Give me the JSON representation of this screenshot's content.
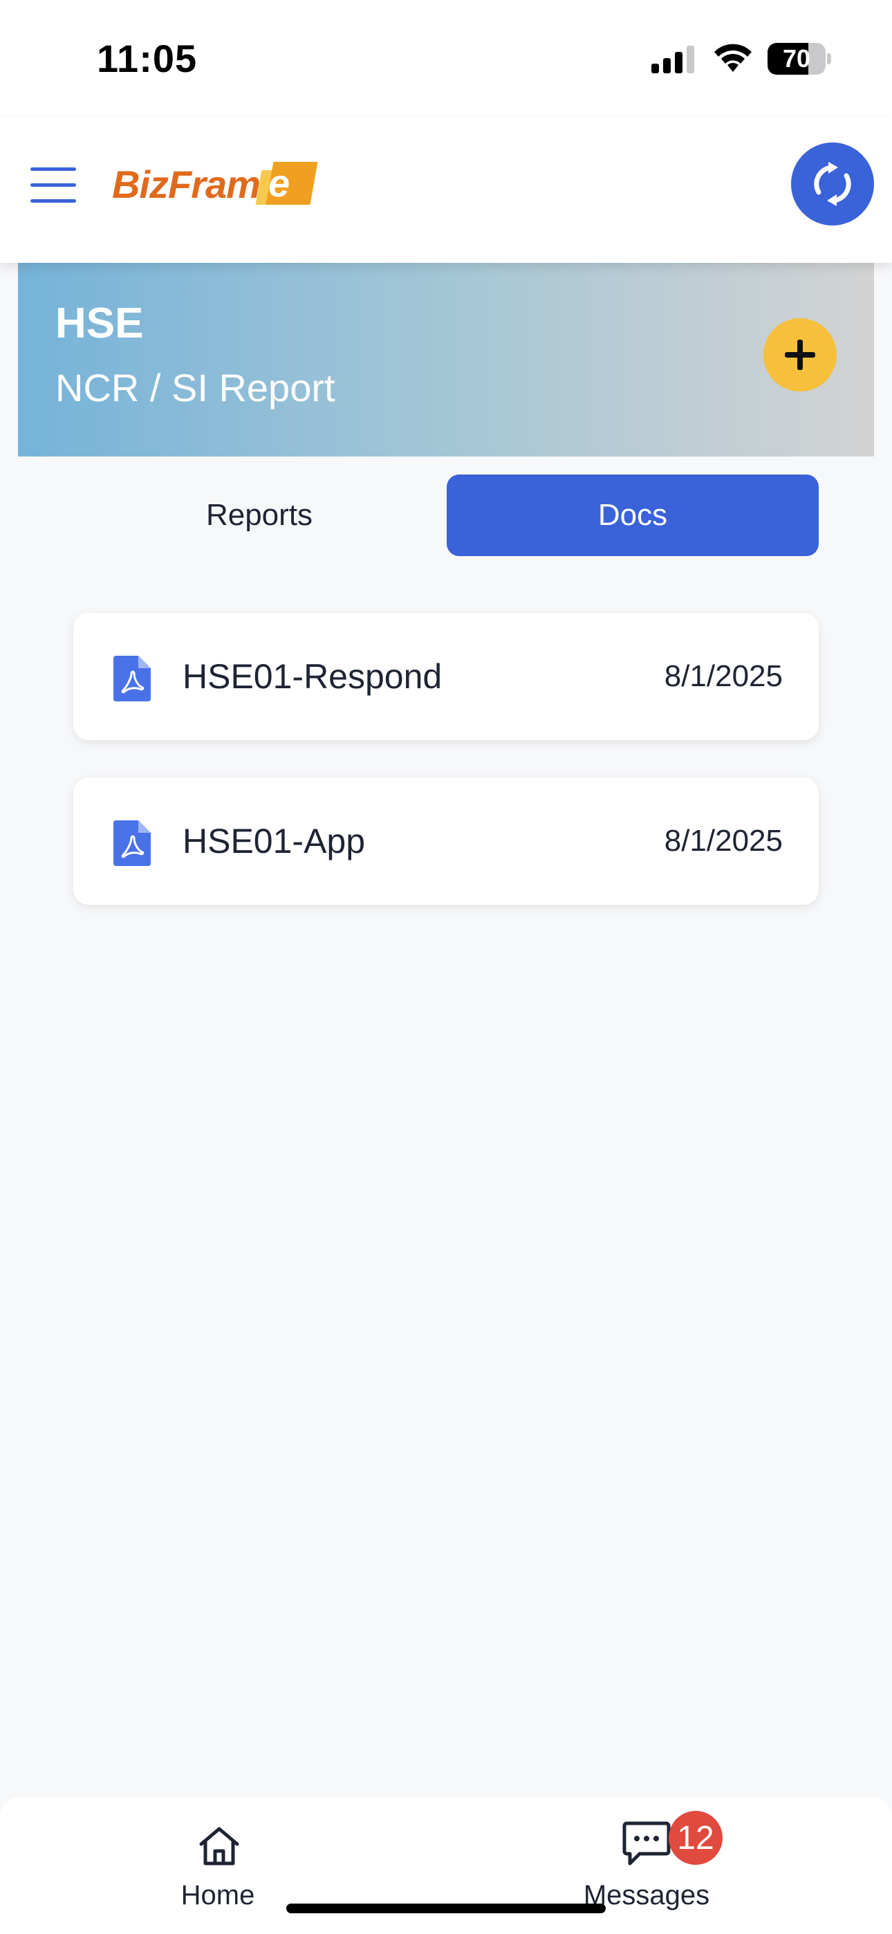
{
  "status_bar": {
    "time": "11:05",
    "battery_level": "70",
    "battery_fraction": 0.7
  },
  "header": {
    "logo_text": "BizFram",
    "logo_letter": "e",
    "menu_icon": "hamburger-menu-icon",
    "sync_icon": "sync-icon"
  },
  "banner": {
    "title": "HSE",
    "subtitle": "NCR / SI Report",
    "add_icon": "plus-icon"
  },
  "tabs": [
    {
      "label": "Reports",
      "active": false
    },
    {
      "label": "Docs",
      "active": true
    }
  ],
  "docs": [
    {
      "name": "HSE01-Respond",
      "date": "8/1/2025",
      "icon": "pdf-file-icon"
    },
    {
      "name": "HSE01-App",
      "date": "8/1/2025",
      "icon": "pdf-file-icon"
    }
  ],
  "bottom_nav": {
    "items": [
      {
        "label": "Home",
        "icon": "home-icon"
      },
      {
        "label": "Messages",
        "icon": "message-icon",
        "badge": "12"
      }
    ]
  },
  "colors": {
    "accent": "#3a62d9",
    "add_button": "#f6c03d",
    "badge": "#e04a3f",
    "logo_orange": "#e06a1c"
  }
}
